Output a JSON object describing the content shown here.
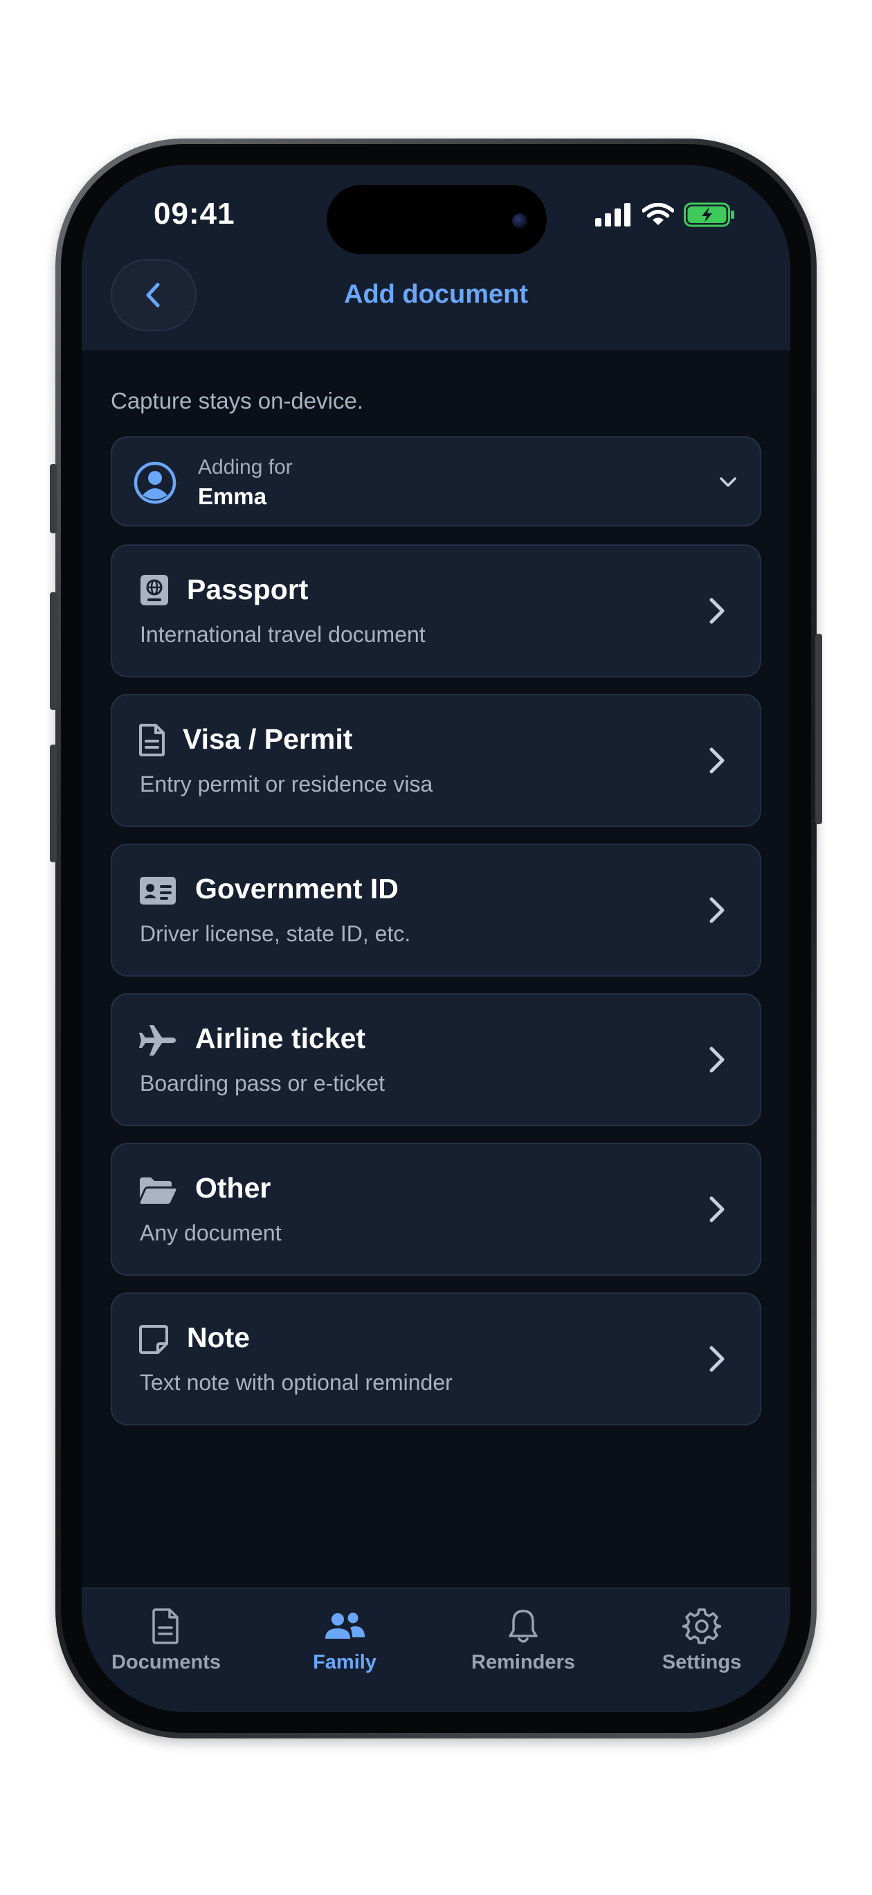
{
  "status_bar": {
    "time": "09:41",
    "icons": [
      "signal-icon",
      "wifi-icon",
      "battery-charging-icon"
    ],
    "battery_color": "#3ec95a"
  },
  "header": {
    "title": "Add document",
    "back_icon": "chevron-left-icon",
    "accent_color": "#6aa7f8"
  },
  "subtitle": "Capture stays on-device.",
  "adding_for": {
    "label": "Adding for",
    "name": "Emma",
    "icon": "user-circle-icon",
    "dropdown_icon": "chevron-down-icon"
  },
  "document_types": [
    {
      "name": "Passport",
      "description": "International travel document",
      "icon": "passport-icon"
    },
    {
      "name": "Visa / Permit",
      "description": "Entry permit or residence visa",
      "icon": "file-text-icon"
    },
    {
      "name": "Government ID",
      "description": "Driver license, state ID, etc.",
      "icon": "id-card-icon"
    },
    {
      "name": "Airline ticket",
      "description": "Boarding pass or e-ticket",
      "icon": "plane-icon"
    },
    {
      "name": "Other",
      "description": "Any document",
      "icon": "folder-open-icon"
    },
    {
      "name": "Note",
      "description": "Text note with optional reminder",
      "icon": "sticky-note-icon"
    }
  ],
  "tab_bar": {
    "tabs": [
      {
        "label": "Documents",
        "icon": "document-icon",
        "active": false
      },
      {
        "label": "Family",
        "icon": "family-icon",
        "active": true
      },
      {
        "label": "Reminders",
        "icon": "bell-icon",
        "active": false
      },
      {
        "label": "Settings",
        "icon": "gear-icon",
        "active": false
      }
    ]
  }
}
